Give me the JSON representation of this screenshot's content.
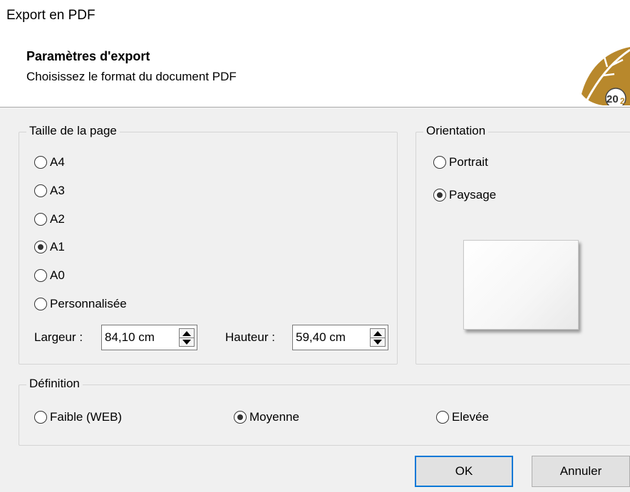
{
  "window": {
    "title": "Export en PDF"
  },
  "header": {
    "title": "Paramètres d'export",
    "subtitle": "Choisissez le format du  document PDF",
    "logo_icon": "gold-leaf-2020-logo-icon"
  },
  "page_size": {
    "legend": "Taille de la page",
    "options": [
      {
        "label": "A4",
        "checked": false
      },
      {
        "label": "A3",
        "checked": false
      },
      {
        "label": "A2",
        "checked": false
      },
      {
        "label": "A1",
        "checked": true
      },
      {
        "label": "A0",
        "checked": false
      },
      {
        "label": "Personnalisée",
        "checked": false
      }
    ],
    "width_label": "Largeur :",
    "width_value": "84,10 cm",
    "height_label": "Hauteur :",
    "height_value": "59,40 cm"
  },
  "orientation": {
    "legend": "Orientation",
    "options": [
      {
        "label": "Portrait",
        "checked": false
      },
      {
        "label": "Paysage",
        "checked": true
      }
    ]
  },
  "definition": {
    "legend": "Définition",
    "options": [
      {
        "label": "Faible (WEB)",
        "checked": false
      },
      {
        "label": "Moyenne",
        "checked": true
      },
      {
        "label": "Elevée",
        "checked": false
      }
    ]
  },
  "buttons": {
    "ok": "OK",
    "cancel": "Annuler"
  },
  "colors": {
    "accent": "#0078d7",
    "logo_gold": "#b8882c",
    "background": "#f0f0f0"
  }
}
